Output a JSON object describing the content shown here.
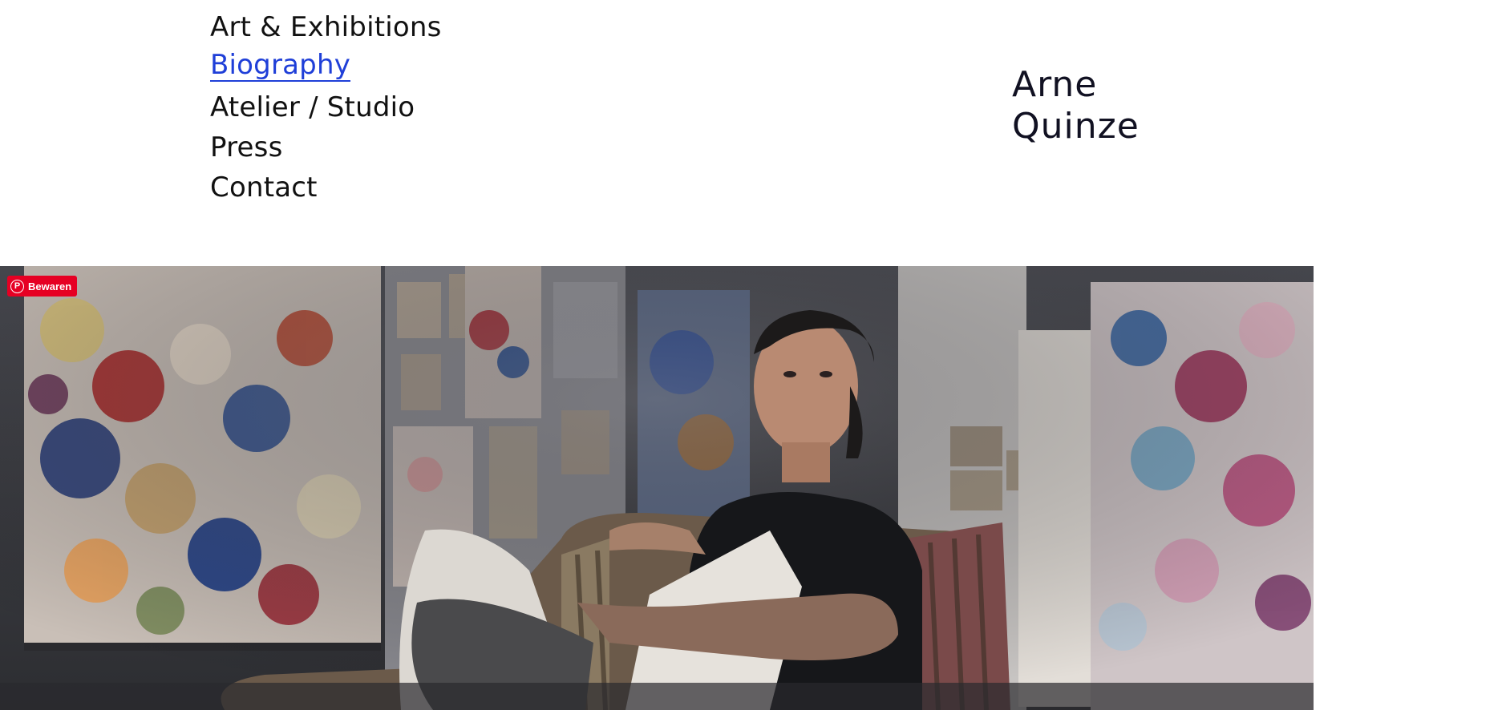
{
  "nav": {
    "items": [
      {
        "label": "Art & Exhibitions"
      },
      {
        "label": "Biography"
      },
      {
        "label": "Atelier / Studio"
      },
      {
        "label": "Press"
      },
      {
        "label": "Contact"
      }
    ]
  },
  "brand": {
    "line1": "Arne",
    "line2": "Quinze"
  },
  "hero": {
    "pin_button": "Bewaren",
    "pin_icon": "pinterest-icon"
  },
  "colors": {
    "link_active": "#1f3fd8",
    "pinterest": "#e60023"
  }
}
